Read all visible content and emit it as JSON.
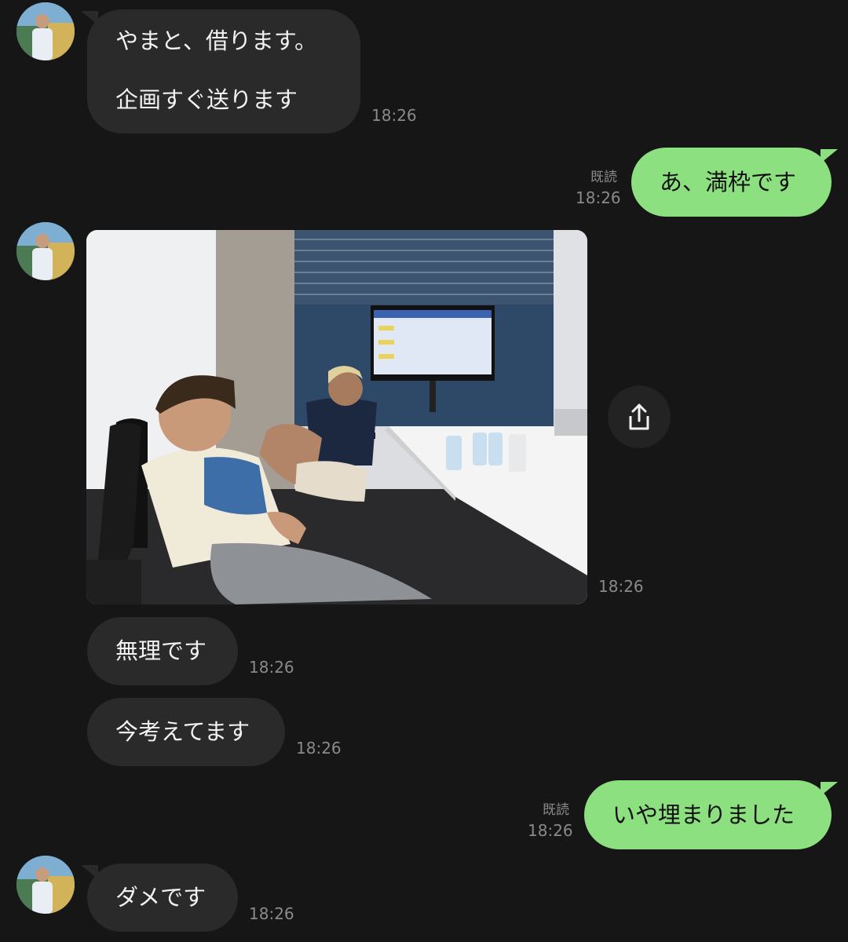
{
  "messages": [
    {
      "side": "in",
      "lines": [
        "やまと、借ります。",
        "企画すぐ送ります"
      ],
      "time": "18:26"
    },
    {
      "side": "out",
      "text": "あ、満枠です",
      "read": "既読",
      "time": "18:26"
    },
    {
      "side": "in",
      "type": "image",
      "time": "18:26"
    },
    {
      "side": "in",
      "text": "無理です",
      "time": "18:26"
    },
    {
      "side": "in",
      "text": "今考えてます",
      "time": "18:26"
    },
    {
      "side": "out",
      "text": "いや埋まりました",
      "read": "既読",
      "time": "18:26"
    },
    {
      "side": "in",
      "text": "ダメです",
      "time": "18:26"
    }
  ],
  "icons": {
    "share": "share-icon",
    "avatar": "avatar-baseball-stadium"
  },
  "colors": {
    "background": "#161616",
    "incoming": "#2a2a2a",
    "outgoing": "#8de07f"
  }
}
